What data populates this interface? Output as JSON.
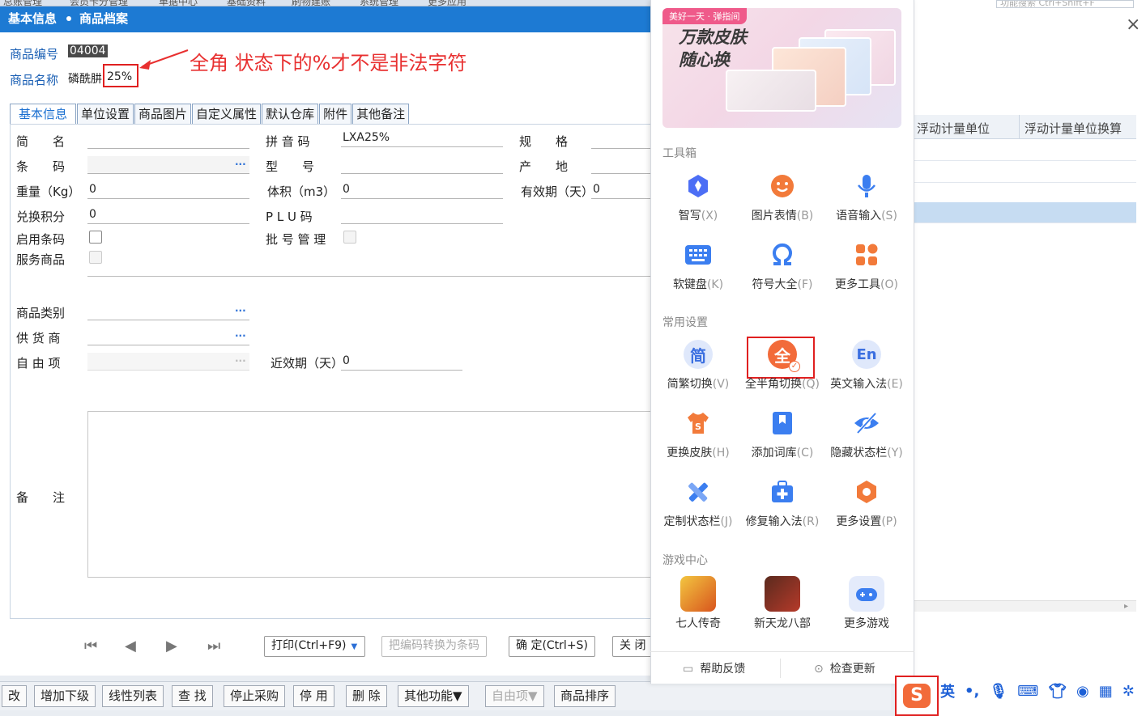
{
  "top_menu": [
    "总账管理",
    "会员卡分管理",
    "单据中心",
    "基础资料",
    "刷物建账",
    "系统管理",
    "更多应用"
  ],
  "top_search_placeholder": "功能搜索 Ctrl+Shift+F",
  "window": {
    "crumb_1": "基本信息",
    "crumb_2": "商品档案",
    "close_glyph": "×"
  },
  "header_fields": {
    "code_label": "商品编号",
    "code_value": "04004",
    "name_label": "商品名称",
    "name_value_prefix": "磷酰肼",
    "name_value_highlight": "25%"
  },
  "annotation": "全角  状态下的%才不是非法字符",
  "tabs": [
    "基本信息",
    "单位设置",
    "商品图片",
    "自定义属性",
    "默认仓库",
    "附件",
    "其他备注"
  ],
  "fields": {
    "short_name": "简　　名",
    "pinyin": "拼 音 码",
    "pinyin_value": "LXA25%",
    "spec": "规　　格",
    "barcode": "条　　码",
    "model": "型　　号",
    "origin": "产　　地",
    "weight": "重量（Kg）",
    "weight_value": "0",
    "volume": "体积（m3）",
    "volume_value": "0",
    "expiry": "有效期（天）",
    "expiry_value": "0",
    "points": "兑换积分",
    "points_value": "0",
    "plu": "P L U 码",
    "enable_barcode": "启用条码",
    "batch": "批 号 管 理",
    "service": "服务商品",
    "category": "商品类别",
    "supplier": "供 货 商",
    "free": "自 由 项",
    "near_expiry": "近效期（天）",
    "near_expiry_value": "0",
    "remark": "备　　注",
    "dots": "···"
  },
  "form_buttons": {
    "print": "打印(Ctrl+F9)",
    "convert": "把编码转换为条码",
    "ok": "确 定(Ctrl+S)",
    "close": "关 闭"
  },
  "bottom_buttons": [
    "改",
    "增加下级",
    "线性列表",
    "查 找",
    "停止采购",
    "停 用",
    "删 除",
    "其他功能▼",
    "自由项▼",
    "商品排序"
  ],
  "grid": {
    "col1": "浮动计量单位",
    "col2": "浮动计量单位换算"
  },
  "ime_menu": {
    "banner_tag": "美好一天 · 弹指间",
    "banner_line1": "万款皮肤",
    "banner_line2": "随心换",
    "sections": {
      "toolbox": "工具箱",
      "settings": "常用设置",
      "games": "游戏中心"
    },
    "tools": [
      {
        "label": "智写",
        "key": "(X)"
      },
      {
        "label": "图片表情",
        "key": "(B)"
      },
      {
        "label": "语音输入",
        "key": "(S)"
      },
      {
        "label": "软键盘",
        "key": "(K)"
      },
      {
        "label": "符号大全",
        "key": "(F)"
      },
      {
        "label": "更多工具",
        "key": "(O)"
      }
    ],
    "settings": [
      {
        "label": "简繁切换",
        "key": "(V)",
        "glyph": "简"
      },
      {
        "label": "全半角切换",
        "key": "(Q)",
        "glyph": "全"
      },
      {
        "label": "英文输入法",
        "key": "(E)",
        "glyph": "En"
      },
      {
        "label": "更换皮肤",
        "key": "(H)"
      },
      {
        "label": "添加词库",
        "key": "(C)"
      },
      {
        "label": "隐藏状态栏",
        "key": "(Y)"
      },
      {
        "label": "定制状态栏",
        "key": "(J)"
      },
      {
        "label": "修复输入法",
        "key": "(R)"
      },
      {
        "label": "更多设置",
        "key": "(P)"
      }
    ],
    "games": [
      "七人传奇",
      "新天龙八部",
      "更多游戏"
    ],
    "footer": {
      "help": "帮助反馈",
      "update": "检查更新"
    }
  },
  "statusbar": {
    "lang": "英",
    "punct": "•,",
    "logo": "S"
  },
  "colors": {
    "title_blue": "#1d7ad3",
    "annotation_red": "#e83030",
    "ime_orange": "#f26b3a"
  }
}
